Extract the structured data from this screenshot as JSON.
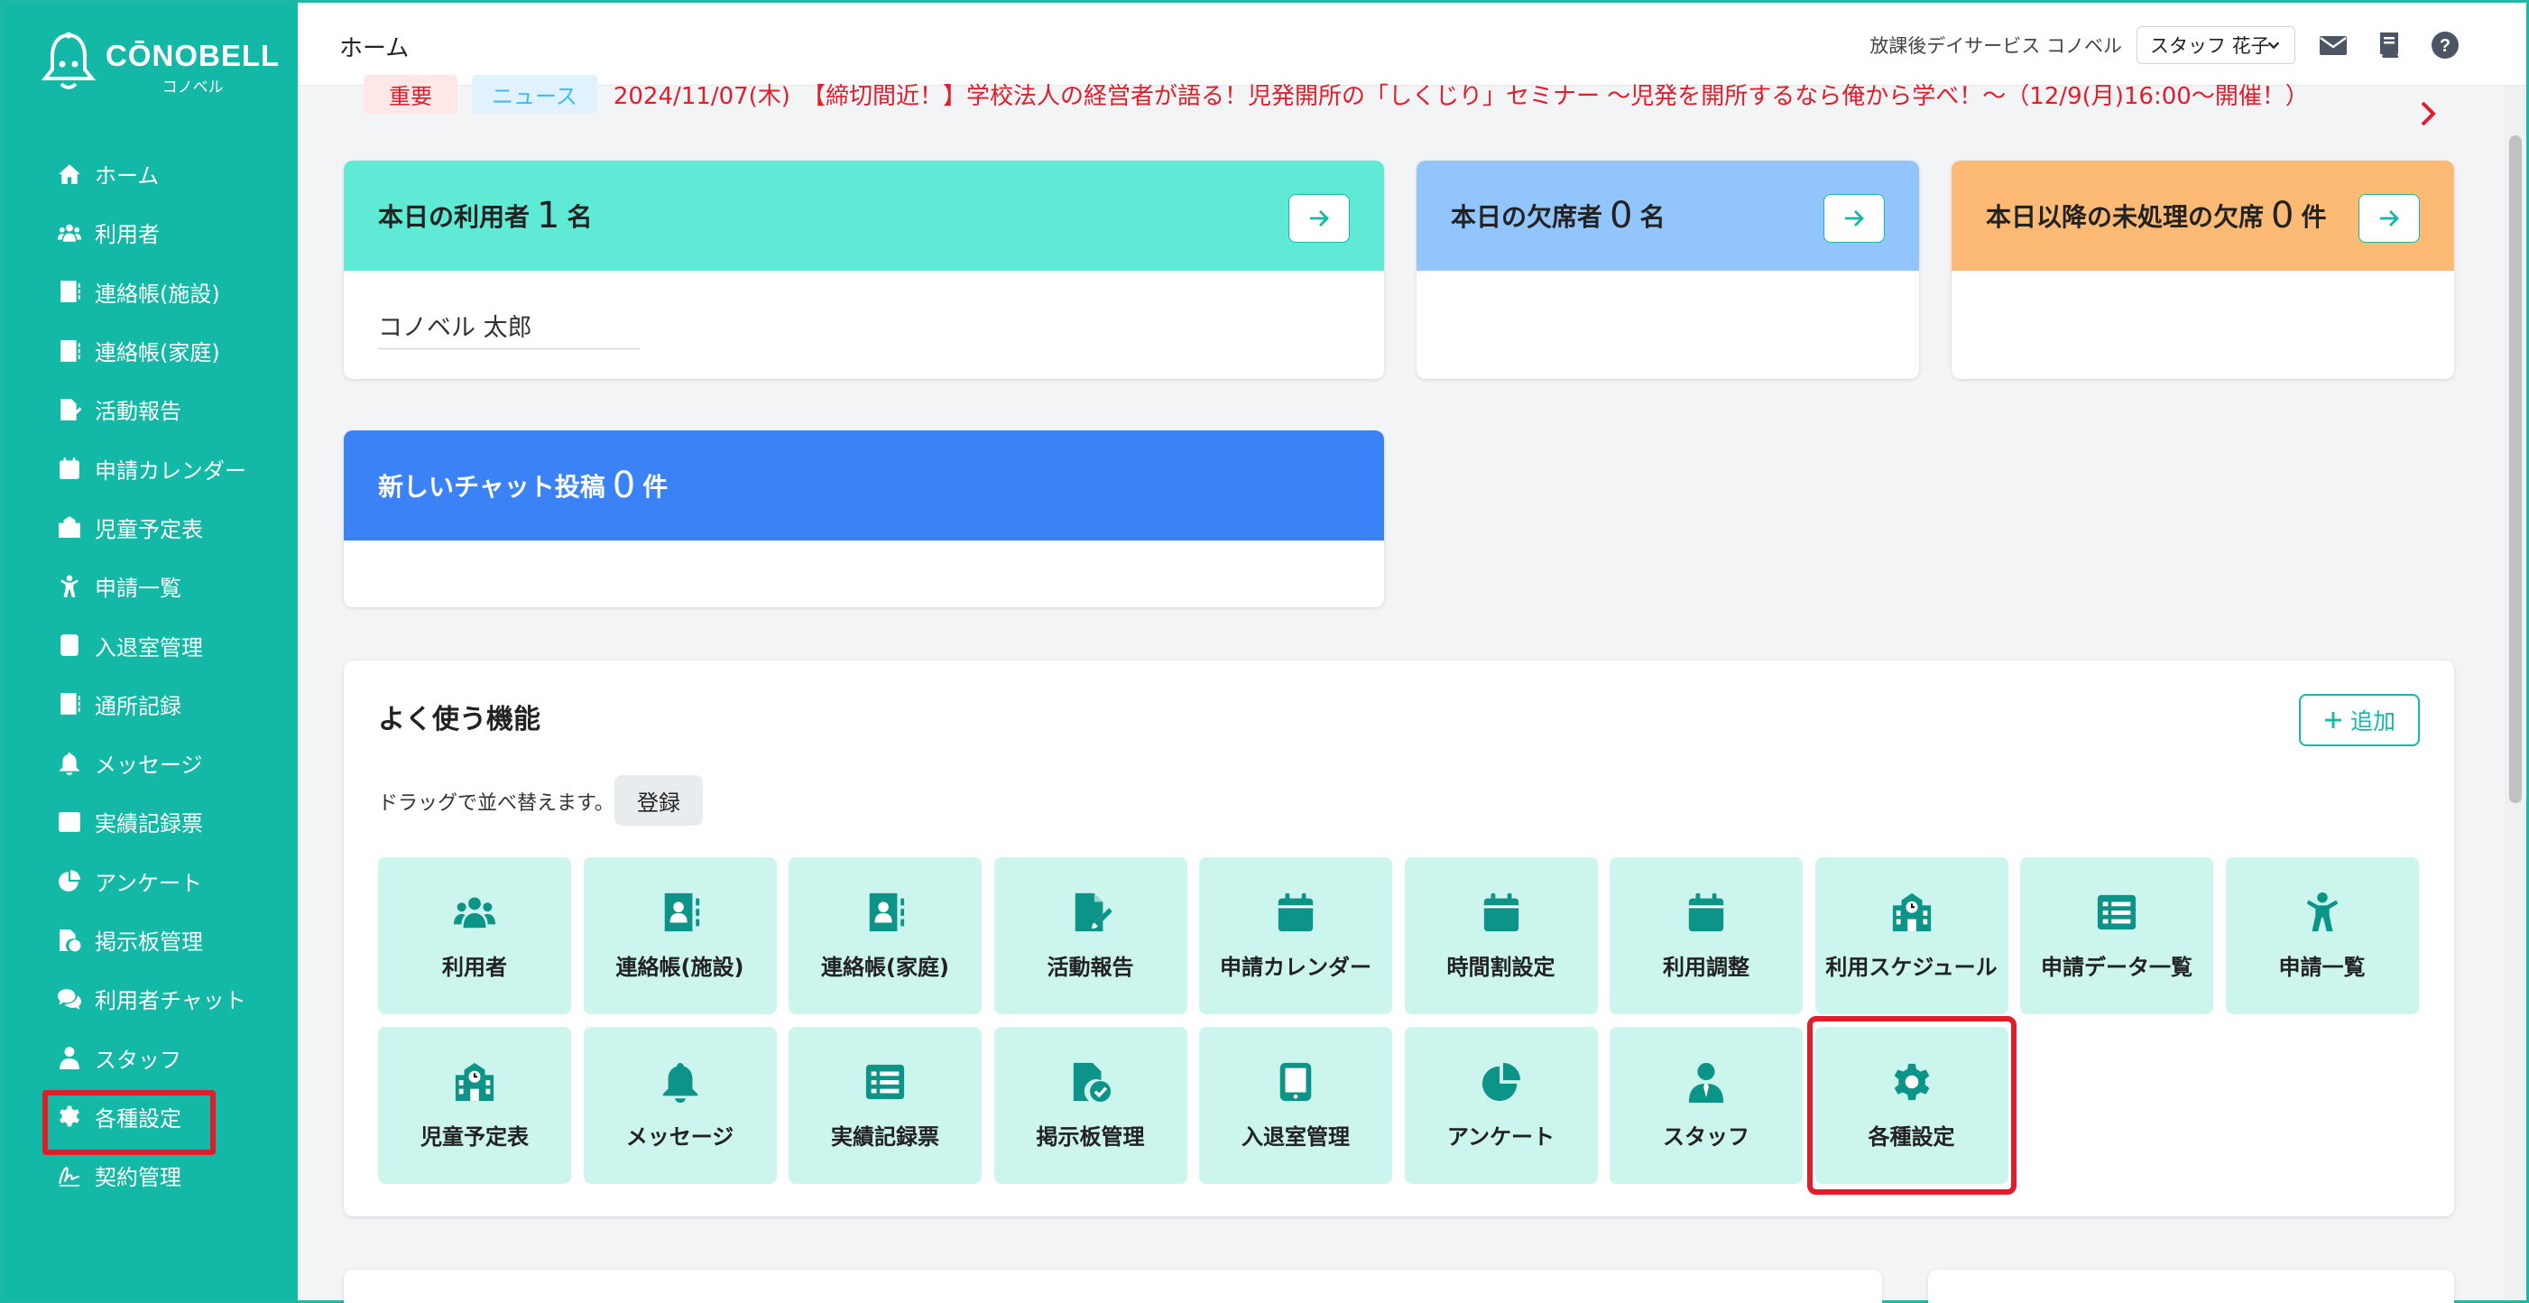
{
  "brand": {
    "name": "CŌNOBELL",
    "sub": "コノベル"
  },
  "sidebar": {
    "items": [
      {
        "label": "ホーム",
        "icon": "home-icon"
      },
      {
        "label": "利用者",
        "icon": "users-icon"
      },
      {
        "label": "連絡帳(施設)",
        "icon": "contact-book-icon"
      },
      {
        "label": "連絡帳(家庭)",
        "icon": "contact-book-icon"
      },
      {
        "label": "活動報告",
        "icon": "report-icon"
      },
      {
        "label": "申請カレンダー",
        "icon": "calendar-icon"
      },
      {
        "label": "児童予定表",
        "icon": "school-icon"
      },
      {
        "label": "申請一覧",
        "icon": "child-icon"
      },
      {
        "label": "入退室管理",
        "icon": "tablet-icon"
      },
      {
        "label": "通所記録",
        "icon": "contact-book-icon"
      },
      {
        "label": "メッセージ",
        "icon": "bell-icon"
      },
      {
        "label": "実績記録票",
        "icon": "list-icon"
      },
      {
        "label": "アンケート",
        "icon": "pie-chart-icon"
      },
      {
        "label": "掲示板管理",
        "icon": "file-check-icon"
      },
      {
        "label": "利用者チャット",
        "icon": "chat-icon"
      },
      {
        "label": "スタッフ",
        "icon": "staff-icon"
      },
      {
        "label": "各種設定",
        "icon": "gear-icon"
      },
      {
        "label": "契約管理",
        "icon": "signature-icon"
      }
    ]
  },
  "header": {
    "title": "ホーム",
    "facility": "放課後デイサービス コノベル",
    "staff": "スタッフ 花子"
  },
  "news": {
    "important": "重要",
    "category": "ニュース",
    "text": "2024/11/07(木)　【締切間近！】学校法人の経営者が語る！児発開所の「しくじり」セミナー 〜児発を開所するなら俺から学べ！〜（12/9(月)16:00〜開催！）"
  },
  "cards": {
    "today_users": {
      "label": "本日の利用者",
      "count": "1",
      "unit": "名",
      "color": "#5eead4",
      "users": [
        "コノベル 太郎"
      ]
    },
    "today_absent": {
      "label": "本日の欠席者",
      "count": "0",
      "unit": "名",
      "color": "#93c5fd"
    },
    "pending_absent": {
      "label": "本日以降の未処理の欠席",
      "count": "0",
      "unit": "件",
      "color": "#fdba74"
    },
    "new_chat": {
      "label": "新しいチャット投稿",
      "count": "0",
      "unit": "件",
      "color": "#3b82f6"
    }
  },
  "favorites": {
    "title": "よく使う機能",
    "add_label": "追加",
    "hint": "ドラッグで並べ替えます。",
    "register_label": "登録",
    "tiles": [
      {
        "label": "利用者",
        "icon": "users-icon"
      },
      {
        "label": "連絡帳(施設)",
        "icon": "contact-book-icon"
      },
      {
        "label": "連絡帳(家庭)",
        "icon": "contact-book-icon"
      },
      {
        "label": "活動報告",
        "icon": "report-icon"
      },
      {
        "label": "申請カレンダー",
        "icon": "calendar-icon"
      },
      {
        "label": "時間割設定",
        "icon": "calendar-icon"
      },
      {
        "label": "利用調整",
        "icon": "calendar-icon"
      },
      {
        "label": "利用スケジュール",
        "icon": "school-icon"
      },
      {
        "label": "申請データ一覧",
        "icon": "list-icon"
      },
      {
        "label": "申請一覧",
        "icon": "child-icon"
      },
      {
        "label": "児童予定表",
        "icon": "school-icon"
      },
      {
        "label": "メッセージ",
        "icon": "bell-icon"
      },
      {
        "label": "実績記録票",
        "icon": "list-icon"
      },
      {
        "label": "掲示板管理",
        "icon": "file-check-icon"
      },
      {
        "label": "入退室管理",
        "icon": "tablet-icon"
      },
      {
        "label": "アンケート",
        "icon": "pie-chart-icon"
      },
      {
        "label": "スタッフ",
        "icon": "staff-icon"
      },
      {
        "label": "各種設定",
        "icon": "gear-icon"
      }
    ]
  },
  "colors": {
    "accent": "#14b8a6",
    "alert": "#e11d2a",
    "tile_bg": "#ccf5ee"
  }
}
